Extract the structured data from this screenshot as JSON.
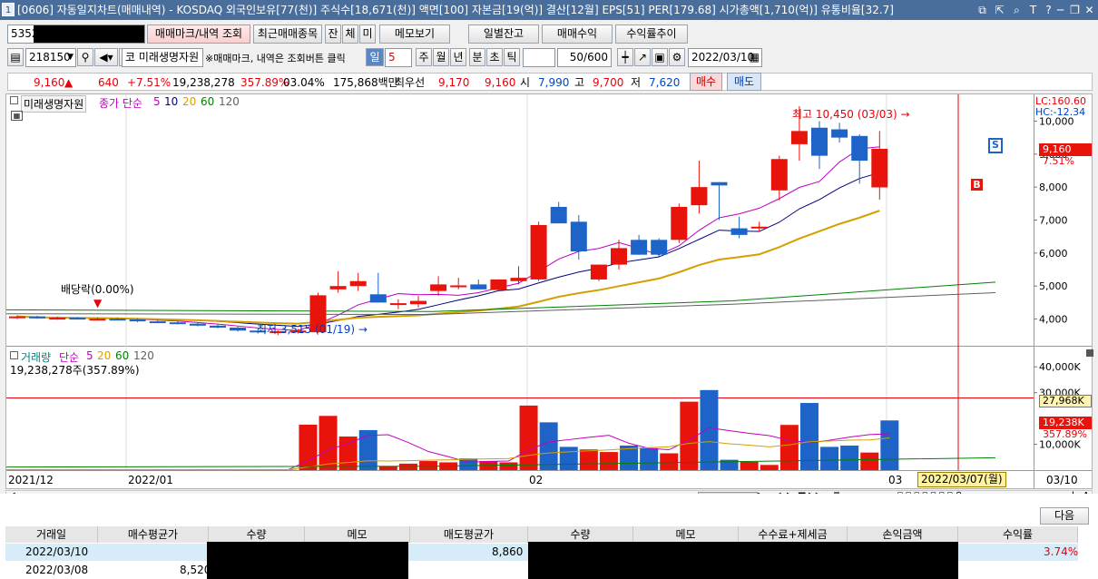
{
  "window": {
    "title": "[0606] 자동일지차트(매매내역) - KOSDAQ 외국인보유[77(천)] 주식수[18,671(천)] 액면[100] 자본금[19(억)] 결산[12월] EPS[51] PER[179.68] 시가총액[1,710(억)] 유통비율[32.7]",
    "tab_num": "1",
    "btn_link": "⧉",
    "btn_minimize": "─",
    "btn_restore": "❐",
    "btn_close": "✕",
    "btn_pin": "⇱",
    "btn_search": "⌕",
    "btn_text": "T",
    "btn_help": "?"
  },
  "toolbar1": {
    "account": "5352",
    "btn_mark": "매매마크/내역 조회",
    "btn_recent": "최근매매종목",
    "btn_jan": "잔",
    "btn_che": "체",
    "btn_mi": "미",
    "btn_memo": "메모보기",
    "btn_daily": "일별잔고",
    "btn_profit": "매매수익",
    "btn_rate": "수익률추이"
  },
  "toolbar2": {
    "code": "218150",
    "stock_flag": "코",
    "stock_name": "미래생명자원",
    "hint": "※매매마크, 내역은 조회버튼 클릭",
    "period_il": "일",
    "period_num": "5",
    "p_ju": "주",
    "p_wol": "월",
    "p_nyeon": "년",
    "p_bun": "분",
    "p_cho": "초",
    "p_tik": "틱",
    "count": "50",
    "count_max": "/600",
    "date": "2022/03/10"
  },
  "quote": {
    "price": "9,160",
    "arrow": "▲",
    "change": "640",
    "change_pct": "+7.51%",
    "volume": "19,238,278",
    "vol_pct": "357.89%",
    "turnover": "03.04%",
    "amount": "175,868백만",
    "priority_label": "최우선",
    "ask": "9,170",
    "bid": "9,160",
    "open_label": "시",
    "open": "7,990",
    "high_label": "고",
    "high": "9,700",
    "low_label": "저",
    "low": "7,620",
    "btn_buy": "매수",
    "btn_sell": "매도"
  },
  "chart_data": [
    {
      "type": "candlestick",
      "title": "미래생명자원",
      "indicator_label": "종가 단순",
      "ma_periods": [
        "5",
        "10",
        "20",
        "60",
        "120"
      ],
      "ma_colors": [
        "#c000c0",
        "#000080",
        "#d4a000",
        "#008000",
        "#606060"
      ],
      "lc_label": "LC:160.60",
      "hc_label": "HC:-12.34",
      "high_annot": "최고 10,450 (03/03) →",
      "low_annot": "최저 3,515 (01/19) →",
      "dividend_annot": "배당락(0.00%)",
      "last_price_tag": "9,160",
      "last_pct_tag": "7.51%",
      "buy_marker": "B",
      "sell_marker": "S",
      "yticks": [
        "10,000",
        "9,000",
        "8,000",
        "7,000",
        "6,000",
        "5,000",
        "4,000"
      ],
      "y_axis": {
        "min": 3300,
        "max": 10700,
        "scale": "linear"
      },
      "candles": [
        [
          4050,
          4110,
          4000,
          4080
        ],
        [
          4080,
          4100,
          4010,
          4020
        ],
        [
          4020,
          4070,
          3980,
          4040
        ],
        [
          4040,
          4060,
          3990,
          4000
        ],
        [
          4000,
          4050,
          3960,
          4010
        ],
        [
          4010,
          4040,
          3960,
          3990
        ],
        [
          3990,
          4020,
          3900,
          3930
        ],
        [
          3930,
          3980,
          3880,
          3900
        ],
        [
          3900,
          3940,
          3840,
          3860
        ],
        [
          3860,
          3890,
          3780,
          3800
        ],
        [
          3800,
          3830,
          3720,
          3740
        ],
        [
          3740,
          3780,
          3620,
          3650
        ],
        [
          3650,
          3700,
          3560,
          3600
        ],
        [
          3600,
          3660,
          3515,
          3630
        ],
        [
          3630,
          3700,
          3560,
          3650
        ],
        [
          3600,
          4800,
          3580,
          4720
        ],
        [
          4900,
          5450,
          4800,
          5000
        ],
        [
          5000,
          5400,
          4850,
          5150
        ],
        [
          4750,
          5400,
          4600,
          4500
        ],
        [
          4450,
          4600,
          4300,
          4480
        ],
        [
          4450,
          4700,
          4350,
          4550
        ],
        [
          4850,
          5300,
          4700,
          5050
        ],
        [
          4980,
          5250,
          4900,
          5020
        ],
        [
          5050,
          5200,
          4950,
          4900
        ],
        [
          4880,
          5200,
          4850,
          5200
        ],
        [
          5150,
          5600,
          5050,
          5250
        ],
        [
          5200,
          6950,
          5150,
          6850
        ],
        [
          7400,
          7550,
          6900,
          6900
        ],
        [
          6950,
          7150,
          5800,
          6050
        ],
        [
          5200,
          5600,
          5150,
          5650
        ],
        [
          5650,
          6400,
          5500,
          6150
        ],
        [
          6400,
          6550,
          5950,
          5950
        ],
        [
          6400,
          6450,
          5900,
          5950
        ],
        [
          6400,
          7500,
          6300,
          7400
        ],
        [
          7450,
          8800,
          7200,
          8000
        ],
        [
          8150,
          8150,
          7000,
          8050
        ],
        [
          6750,
          7100,
          6450,
          6550
        ],
        [
          6800,
          6950,
          6650,
          6800
        ],
        [
          7900,
          8950,
          7600,
          8850
        ],
        [
          9300,
          10450,
          8800,
          9700
        ],
        [
          9800,
          10000,
          8550,
          8950
        ],
        [
          9750,
          9950,
          9350,
          9500
        ],
        [
          9550,
          9600,
          8100,
          8800
        ],
        [
          7990,
          9700,
          7620,
          9160
        ]
      ],
      "bars_up": [
        true,
        false,
        true,
        false,
        true,
        false,
        true,
        false,
        true,
        false,
        true,
        false,
        true,
        false,
        true,
        true,
        true,
        false,
        false,
        true,
        true,
        true,
        false,
        false,
        true,
        true,
        true,
        false,
        false,
        true,
        true,
        false,
        false,
        true,
        true,
        false,
        false,
        true,
        true,
        true,
        false,
        false,
        false,
        true
      ]
    },
    {
      "type": "bar",
      "title": "거래량",
      "indicator_label": "단순",
      "ma_periods": [
        "5",
        "20",
        "60",
        "120"
      ],
      "value_label": "19,238,278주(357.89%)",
      "yticks": [
        "40,000K",
        "30,000K",
        "10,000K"
      ],
      "y_axis": {
        "min": 0,
        "max": 45000
      },
      "volume_k": [
        150,
        130,
        120,
        110,
        100,
        120,
        110,
        100,
        130,
        140,
        120,
        110,
        100,
        120,
        110,
        17600,
        21000,
        13000,
        15500,
        1500,
        2500,
        3500,
        3000,
        4500,
        3500,
        3000,
        25000,
        18500,
        9000,
        8000,
        7000,
        9500,
        8500,
        6500,
        26500,
        31000,
        4000,
        3200,
        2000,
        17500,
        26000,
        9000,
        9500,
        6800,
        19238
      ],
      "ref_level_tag": "27,968K",
      "ref_level": 27968,
      "last_tag": "19,238K",
      "pct_tag": "357.89%"
    },
    {
      "type": "axis",
      "x_labels": [
        "2021/12",
        "2022/01",
        "02",
        "03"
      ],
      "cursor_date": "2022/03/07(월)",
      "right_date": "03/10"
    }
  ],
  "scrollbar": {
    "btn_left": "◀",
    "btn_right": "▶",
    "b1": "◀",
    "b2": "▶",
    "b3": "■",
    "b4": "▶▶",
    "zoom_out": "−",
    "zoom_in": "+",
    "expand": "A"
  },
  "grid": {
    "btn_next": "다음",
    "columns": [
      "거래일",
      "매수평균가",
      "수량",
      "메모",
      "매도평균가",
      "수량",
      "메모",
      "수수료+제세금",
      "손익금액",
      "수익률"
    ],
    "rows": [
      {
        "date": "2022/03/10",
        "buy_avg": "",
        "sell_avg": "8,860",
        "rate": "3.74%"
      },
      {
        "date": "2022/03/08",
        "buy_avg": "8,520",
        "sell_avg": "",
        "rate": ""
      }
    ]
  },
  "colors": {
    "up": "#e8140c",
    "down": "#1e64c8",
    "title_bar": "#4a6e9c",
    "cursor_line": "#e8000b"
  }
}
